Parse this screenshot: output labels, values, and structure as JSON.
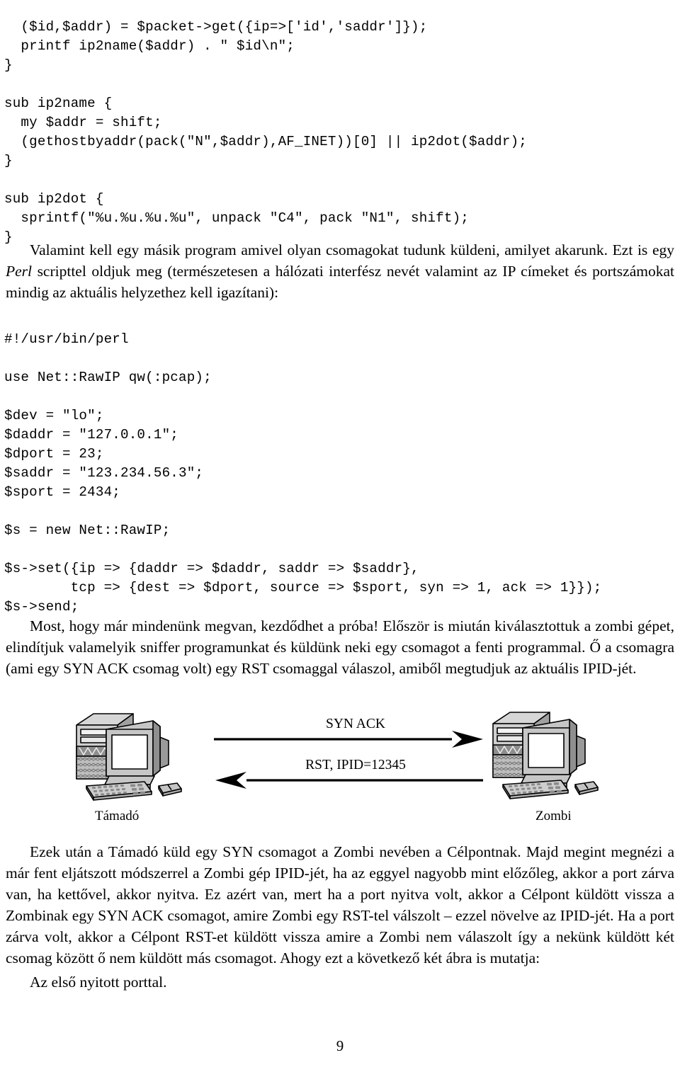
{
  "code_block_1": {
    "lines": "  ($id,$addr) = $packet->get({ip=>['id','saddr']});\n  printf ip2name($addr) . \" $id\\n\";\n}\n\nsub ip2name {\n  my $addr = shift;\n  (gethostbyaddr(pack(\"N\",$addr),AF_INET))[0] || ip2dot($addr);\n}\n\nsub ip2dot {\n  sprintf(\"%u.%u.%u.%u\", unpack \"C4\", pack \"N1\", shift);\n}"
  },
  "paragraph_1": {
    "part_a": "Valamint kell egy másik program amivel olyan csomagokat tudunk küldeni, amilyet akarunk. Ezt is egy ",
    "italic": "Perl",
    "part_b": " scripttel oldjuk meg (természetesen a hálózati interfész nevét valamint az IP címeket és portszámokat mindig az aktuális helyzethez kell igazítani):"
  },
  "code_block_2": {
    "lines": "#!/usr/bin/perl\n\nuse Net::RawIP qw(:pcap);\n\n$dev = \"lo\";\n$daddr = \"127.0.0.1\";\n$dport = 23;\n$saddr = \"123.234.56.3\";\n$sport = 2434;\n\n$s = new Net::RawIP;\n\n$s->set({ip => {daddr => $daddr, saddr => $saddr},\n        tcp => {dest => $dport, source => $sport, syn => 1, ack => 1}});\n$s->send;"
  },
  "paragraph_2": {
    "text": "Most, hogy már mindenünk megvan, kezdődhet a próba! Először is miután kiválasztottuk a zombi gépet, elindítjuk valamelyik sniffer programunkat és küldünk neki egy csomagot a fenti programmal. Ő a csomagra (ami egy SYN ACK csomag volt) egy RST csomaggal válaszol, amiből megtudjuk az aktuális IPID-jét."
  },
  "figure": {
    "left_computer_label": "Támadó",
    "right_computer_label": "Zombi",
    "arrow_top_label": "SYN ACK",
    "arrow_bottom_label": "RST, IPID=12345",
    "colors": {
      "case_light": "#d8d8d8",
      "case_mid": "#b4b4b4",
      "case_dark": "#8c8c8c",
      "screen": "#ffffff",
      "outline": "#000000"
    }
  },
  "paragraph_3": {
    "text": "Ezek után a Támadó küld egy SYN csomagot a Zombi nevében a Célpontnak. Majd megint megnézi a már fent eljátszott módszerrel a Zombi gép IPID-jét, ha az eggyel nagyobb mint előzőleg, akkor a port zárva van, ha kettővel, akkor nyitva. Ez azért van, mert ha a port nyitva volt, akkor a Célpont küldött vissza a Zombinak egy SYN ACK csomagot, amire Zombi egy RST-tel válszolt – ezzel növelve az IPID-jét. Ha a port zárva volt, akkor a Célpont RST-et küldött vissza amire a Zombi nem válaszolt így a nekünk küldött két csomag között ő nem küldött más csomagot. Ahogy ezt a következő két ábra is mutatja:"
  },
  "paragraph_4": {
    "text": "Az első nyitott porttal."
  },
  "page_number": "9"
}
